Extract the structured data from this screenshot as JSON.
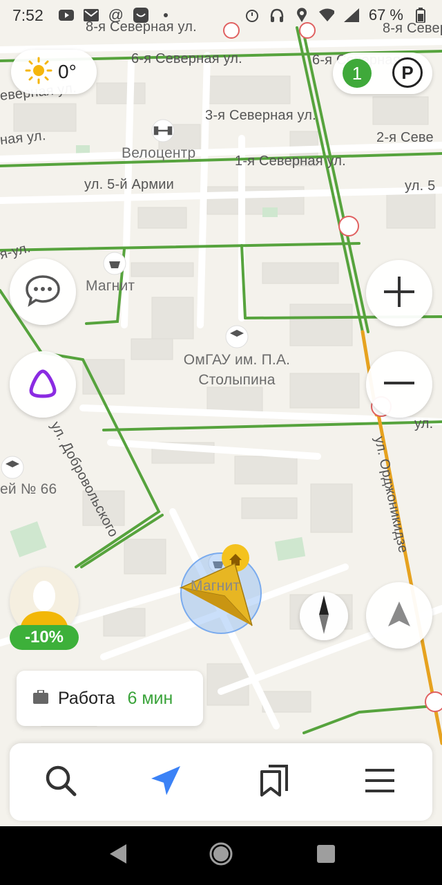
{
  "status_bar": {
    "time": "7:52",
    "battery": "67 %"
  },
  "weather": {
    "temperature": "0°"
  },
  "top_right": {
    "traffic_level": "1",
    "parking_label": "P"
  },
  "map": {
    "streets": [
      "8-я Северная ул.",
      "6-я Северная ул.",
      "6-я Северная",
      "8-я Север",
      "еверная ул.",
      "ная ул.",
      "3-я Северная ул.",
      "2-я Севе",
      "1-я Северная ул.",
      "ул. 5-й Армии",
      "ул. 5",
      "я-ул.",
      "ул. Добровольского",
      "ул. Орджоникидзе",
      "ул."
    ],
    "pois": {
      "velocenter": "Велоцентр",
      "magnit1": "Магнит",
      "omgau": "ОмГАУ им. П.А. Столыпина",
      "lyceum": "ей № 66",
      "magnit2": "Магнит"
    }
  },
  "alice_badge": "-10%",
  "work_card": {
    "label": "Работа",
    "time": "6 мин"
  },
  "icons": {
    "weather": "sun-icon",
    "chat": "chat-bubble-icon",
    "alice": "alice-icon",
    "zoom_in": "plus-icon",
    "zoom_out": "minus-icon",
    "compass": "compass-icon",
    "navigate": "navigation-arrow-icon",
    "search": "search-icon",
    "route": "route-arrow-icon",
    "bookmarks": "bookmarks-icon",
    "menu": "menu-icon"
  },
  "colors": {
    "accent_blue": "#3b82f6",
    "traffic_green": "#3fa93a",
    "traffic_orange": "#e8a317",
    "user_arrow": "#e7b623"
  }
}
